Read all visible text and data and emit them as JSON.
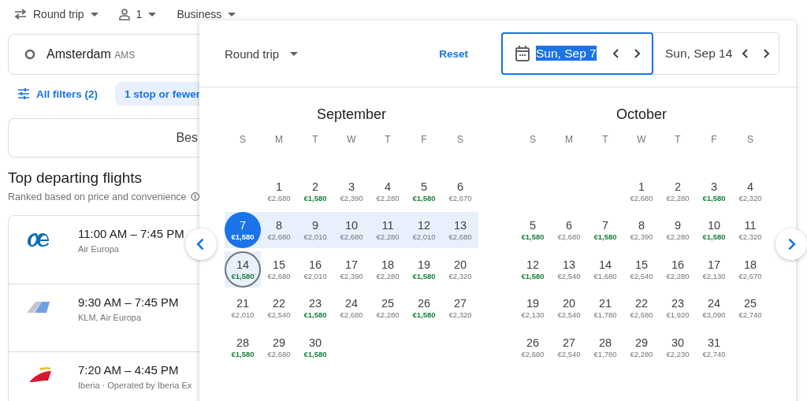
{
  "top_bar": {
    "trip_type": "Round trip",
    "passengers": "1",
    "cabin": "Business"
  },
  "origin": {
    "city": "Amsterdam",
    "code": "AMS"
  },
  "filters": [
    {
      "label": "All filters (2)",
      "kind": "button",
      "selected": false
    },
    {
      "label": "1 stop or fewer",
      "kind": "chip",
      "selected": true
    }
  ],
  "sort": {
    "label": "Bes"
  },
  "section": {
    "title": "Top departing flights",
    "subtitle": "Ranked based on price and convenience"
  },
  "flights": [
    {
      "times": "11:00 AM – 7:45 PM",
      "airline": "Air Europa",
      "kind": "ae"
    },
    {
      "times": "9:30 AM – 7:45 PM",
      "airline": "KLM, Air Europa",
      "kind": "tail"
    },
    {
      "times": "7:20 AM – 4:45 PM",
      "airline": "Iberia · Operated by Iberia Ex",
      "kind": "wing"
    }
  ],
  "dialog": {
    "trip_type": "Round trip",
    "reset": "Reset",
    "departure": {
      "value": "Sun, Sep 7",
      "focused": true
    },
    "return": {
      "value": "Sun, Sep 14",
      "focused": false
    },
    "months": [
      {
        "name": "September",
        "weekdays": [
          "S",
          "M",
          "T",
          "W",
          "T",
          "F",
          "S"
        ],
        "days": [
          {
            "day": "1",
            "price": "€2,680",
            "cheap": false,
            "kind": "day",
            "in_range": false
          },
          {
            "day": "2",
            "price": "€1,580",
            "cheap": true,
            "kind": "day",
            "in_range": false
          },
          {
            "day": "3",
            "price": "€2,390",
            "cheap": false,
            "kind": "day",
            "in_range": false
          },
          {
            "day": "4",
            "price": "€2,280",
            "cheap": false,
            "kind": "day",
            "in_range": false
          },
          {
            "day": "5",
            "price": "€1,580",
            "cheap": true,
            "kind": "day",
            "in_range": false
          },
          {
            "day": "6",
            "price": "€2,670",
            "cheap": false,
            "kind": "day",
            "in_range": false
          },
          {
            "day": "7",
            "price": "€1,580",
            "cheap": true,
            "kind": "departure",
            "in_range": true
          },
          {
            "day": "8",
            "price": "€2,680",
            "cheap": false,
            "kind": "day",
            "in_range": true
          },
          {
            "day": "9",
            "price": "€2,010",
            "cheap": false,
            "kind": "day",
            "in_range": true
          },
          {
            "day": "10",
            "price": "€2,680",
            "cheap": false,
            "kind": "day",
            "in_range": true
          },
          {
            "day": "11",
            "price": "€2,280",
            "cheap": false,
            "kind": "day",
            "in_range": true
          },
          {
            "day": "12",
            "price": "€2,010",
            "cheap": false,
            "kind": "day",
            "in_range": true
          },
          {
            "day": "13",
            "price": "€2,680",
            "cheap": false,
            "kind": "day",
            "in_range": true
          },
          {
            "day": "14",
            "price": "€1,580",
            "cheap": true,
            "kind": "return",
            "in_range": true
          },
          {
            "day": "15",
            "price": "€2,680",
            "cheap": false,
            "kind": "day",
            "in_range": false
          },
          {
            "day": "16",
            "price": "€2,010",
            "cheap": false,
            "kind": "day",
            "in_range": false
          },
          {
            "day": "17",
            "price": "€2,390",
            "cheap": false,
            "kind": "day",
            "in_range": false
          },
          {
            "day": "18",
            "price": "€2,280",
            "cheap": false,
            "kind": "day",
            "in_range": false
          },
          {
            "day": "19",
            "price": "€1,580",
            "cheap": true,
            "kind": "day",
            "in_range": false
          },
          {
            "day": "20",
            "price": "€2,320",
            "cheap": false,
            "kind": "day",
            "in_range": false
          },
          {
            "day": "21",
            "price": "€2,010",
            "cheap": false,
            "kind": "day",
            "in_range": false
          },
          {
            "day": "22",
            "price": "€2,540",
            "cheap": false,
            "kind": "day",
            "in_range": false
          },
          {
            "day": "23",
            "price": "€1,580",
            "cheap": true,
            "kind": "day",
            "in_range": false
          },
          {
            "day": "24",
            "price": "€2,680",
            "cheap": false,
            "kind": "day",
            "in_range": false
          },
          {
            "day": "25",
            "price": "€2,280",
            "cheap": false,
            "kind": "day",
            "in_range": false
          },
          {
            "day": "26",
            "price": "€1,580",
            "cheap": true,
            "kind": "day",
            "in_range": false
          },
          {
            "day": "27",
            "price": "€2,320",
            "cheap": false,
            "kind": "day",
            "in_range": false
          },
          {
            "day": "28",
            "price": "€1,580",
            "cheap": true,
            "kind": "day",
            "in_range": false
          },
          {
            "day": "29",
            "price": "€2,680",
            "cheap": false,
            "kind": "day",
            "in_range": false
          },
          {
            "day": "30",
            "price": "€1,580",
            "cheap": true,
            "kind": "day",
            "in_range": false
          }
        ]
      },
      {
        "name": "October",
        "weekdays": [
          "S",
          "M",
          "T",
          "W",
          "T",
          "F",
          "S"
        ],
        "days": [
          {
            "day": "1",
            "price": "€2,680",
            "cheap": false,
            "kind": "day",
            "in_range": false
          },
          {
            "day": "2",
            "price": "€2,280",
            "cheap": false,
            "kind": "day",
            "in_range": false
          },
          {
            "day": "3",
            "price": "€1,580",
            "cheap": true,
            "kind": "day",
            "in_range": false
          },
          {
            "day": "4",
            "price": "€2,320",
            "cheap": false,
            "kind": "day",
            "in_range": false
          },
          {
            "day": "5",
            "price": "€1,580",
            "cheap": true,
            "kind": "day",
            "in_range": false
          },
          {
            "day": "6",
            "price": "€2,680",
            "cheap": false,
            "kind": "day",
            "in_range": false
          },
          {
            "day": "7",
            "price": "€1,580",
            "cheap": true,
            "kind": "day",
            "in_range": false
          },
          {
            "day": "8",
            "price": "€2,390",
            "cheap": false,
            "kind": "day",
            "in_range": false
          },
          {
            "day": "9",
            "price": "€2,280",
            "cheap": false,
            "kind": "day",
            "in_range": false
          },
          {
            "day": "10",
            "price": "€1,580",
            "cheap": true,
            "kind": "day",
            "in_range": false
          },
          {
            "day": "11",
            "price": "€2,320",
            "cheap": false,
            "kind": "day",
            "in_range": false
          },
          {
            "day": "12",
            "price": "€1,580",
            "cheap": true,
            "kind": "day",
            "in_range": false
          },
          {
            "day": "13",
            "price": "€2,540",
            "cheap": false,
            "kind": "day",
            "in_range": false
          },
          {
            "day": "14",
            "price": "€1,680",
            "cheap": false,
            "kind": "day",
            "in_range": false
          },
          {
            "day": "15",
            "price": "€2,540",
            "cheap": false,
            "kind": "day",
            "in_range": false
          },
          {
            "day": "16",
            "price": "€2,280",
            "cheap": false,
            "kind": "day",
            "in_range": false
          },
          {
            "day": "17",
            "price": "€2,130",
            "cheap": false,
            "kind": "day",
            "in_range": false
          },
          {
            "day": "18",
            "price": "€2,670",
            "cheap": false,
            "kind": "day",
            "in_range": false
          },
          {
            "day": "19",
            "price": "€2,130",
            "cheap": false,
            "kind": "day",
            "in_range": false
          },
          {
            "day": "20",
            "price": "€2,540",
            "cheap": false,
            "kind": "day",
            "in_range": false
          },
          {
            "day": "21",
            "price": "€1,780",
            "cheap": false,
            "kind": "day",
            "in_range": false
          },
          {
            "day": "22",
            "price": "€2,680",
            "cheap": false,
            "kind": "day",
            "in_range": false
          },
          {
            "day": "23",
            "price": "€1,920",
            "cheap": false,
            "kind": "day",
            "in_range": false
          },
          {
            "day": "24",
            "price": "€3,090",
            "cheap": false,
            "kind": "day",
            "in_range": false
          },
          {
            "day": "25",
            "price": "€2,740",
            "cheap": false,
            "kind": "day",
            "in_range": false
          },
          {
            "day": "26",
            "price": "€2,680",
            "cheap": false,
            "kind": "day",
            "in_range": false
          },
          {
            "day": "27",
            "price": "€2,540",
            "cheap": false,
            "kind": "day",
            "in_range": false
          },
          {
            "day": "28",
            "price": "€1,780",
            "cheap": false,
            "kind": "day",
            "in_range": false
          },
          {
            "day": "29",
            "price": "€2,280",
            "cheap": false,
            "kind": "day",
            "in_range": false
          },
          {
            "day": "30",
            "price": "€2,230",
            "cheap": false,
            "kind": "day",
            "in_range": false
          },
          {
            "day": "31",
            "price": "€2,740",
            "cheap": false,
            "kind": "day",
            "in_range": false
          }
        ]
      }
    ]
  }
}
